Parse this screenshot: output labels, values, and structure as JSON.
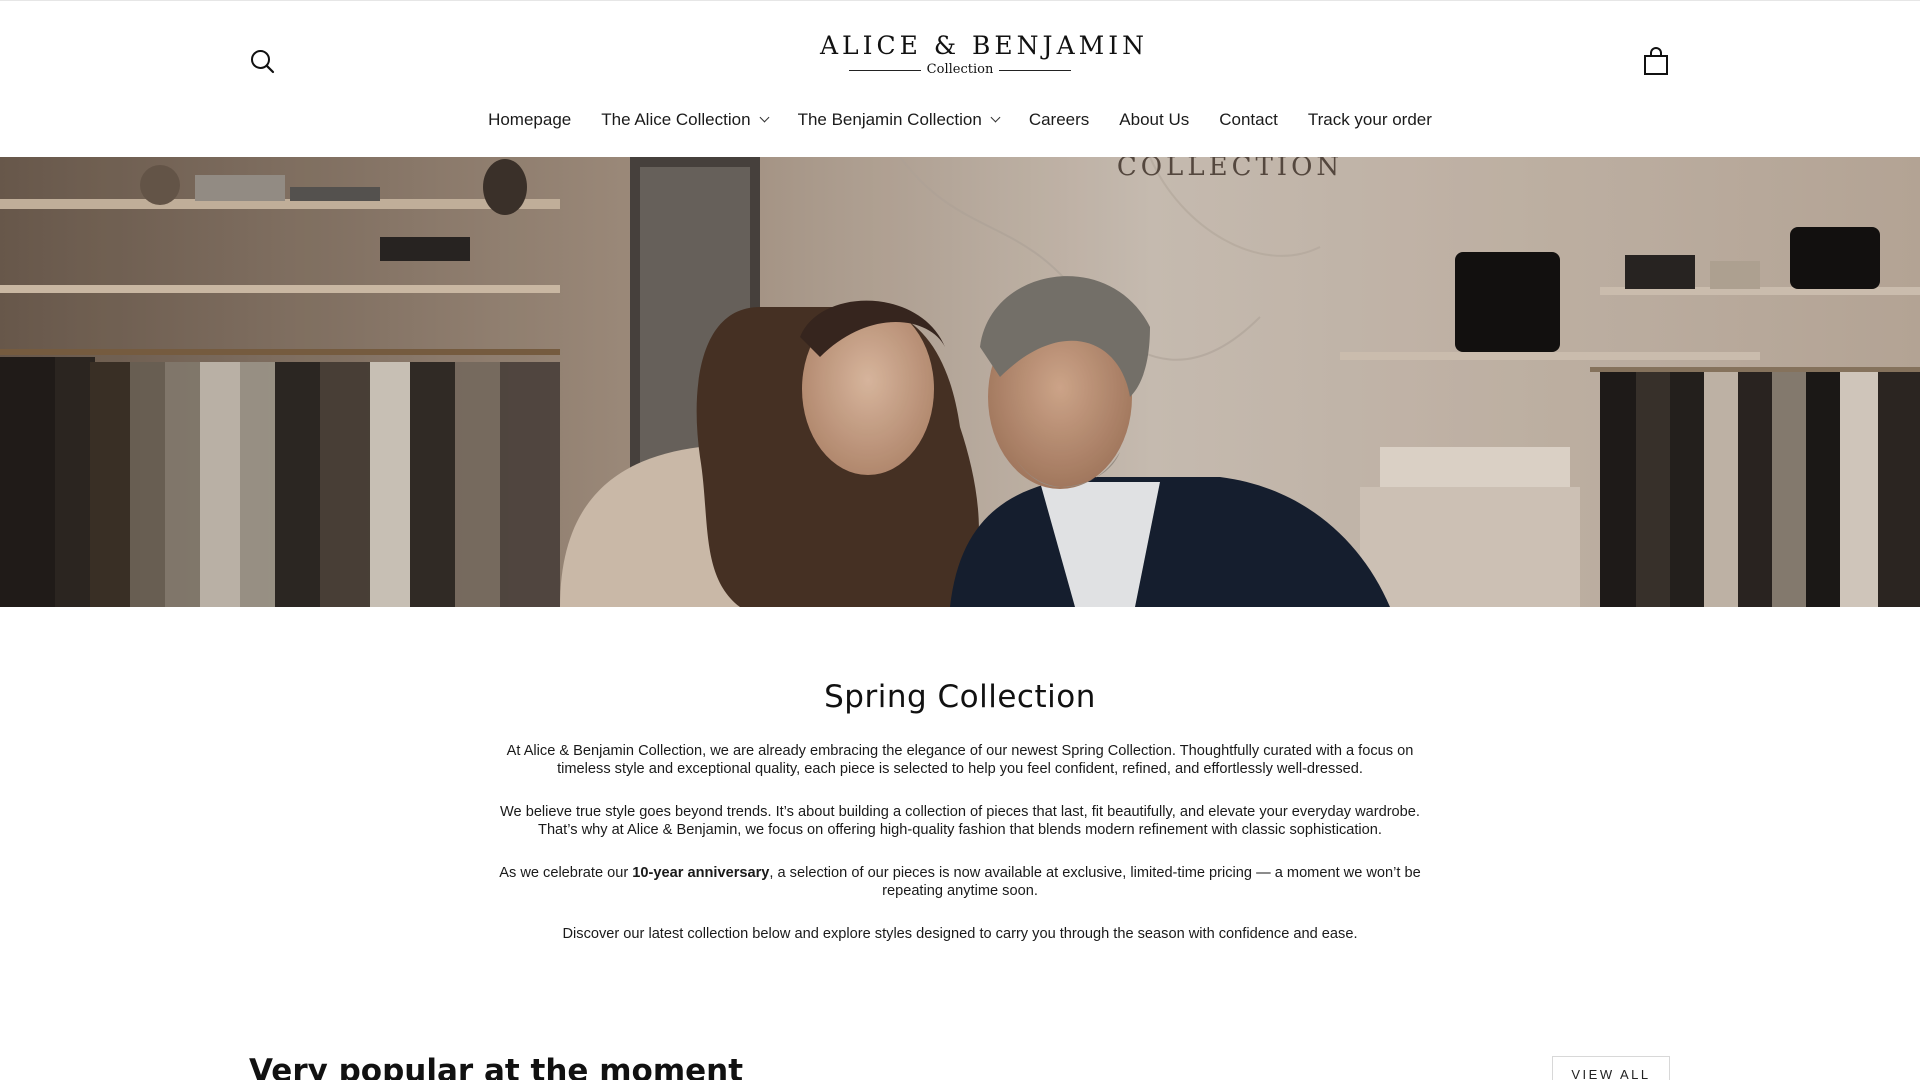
{
  "brand": {
    "name": "ALICE & BENJAMIN",
    "subtitle": "Collection"
  },
  "header": {
    "search_icon": "search-icon",
    "cart_icon": "shopping-bag-icon"
  },
  "nav": {
    "items": [
      {
        "label": "Homepage",
        "has_dropdown": false
      },
      {
        "label": "The Alice Collection",
        "has_dropdown": true
      },
      {
        "label": "The Benjamin Collection",
        "has_dropdown": true
      },
      {
        "label": "Careers",
        "has_dropdown": false
      },
      {
        "label": "About Us",
        "has_dropdown": false
      },
      {
        "label": "Contact",
        "has_dropdown": false
      },
      {
        "label": "Track your order",
        "has_dropdown": false
      }
    ]
  },
  "hero": {
    "store_sign": "COLLECTION"
  },
  "intro": {
    "title": "Spring Collection",
    "p1": "At Alice & Benjamin Collection, we are already embracing the elegance of our newest Spring Collection. Thoughtfully curated with a focus on timeless style and exceptional quality, each piece is selected to help you feel confident, refined, and effortlessly well-dressed.",
    "p2": "We believe true style goes beyond trends. It’s about building a collection of pieces that last, fit beautifully, and elevate your everyday wardrobe. That’s why at Alice & Benjamin, we focus on offering high-quality fashion that blends modern refinement with classic sophistication.",
    "p3_before": "As we celebrate our ",
    "p3_bold": "10-year anniversary",
    "p3_after": ", a selection of our pieces is now available at exclusive, limited-time pricing — a moment we won’t be repeating anytime soon.",
    "p4": "Discover our latest collection below and explore styles designed to carry you through the season with confidence and ease."
  },
  "popular": {
    "title": "Very popular at the moment",
    "view_all_label": "VIEW ALL"
  },
  "colors": {
    "text": "#111111",
    "border": "#d8d8d8",
    "hero_wall": "#cfc3b6"
  }
}
